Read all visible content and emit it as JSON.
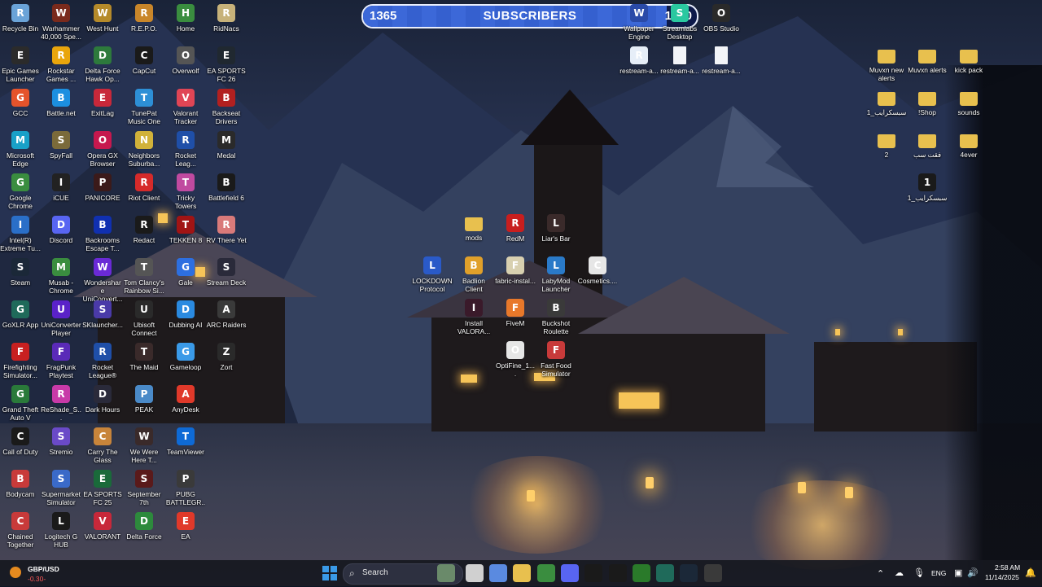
{
  "subscriber_widget": {
    "current": "1365",
    "label": "SUBSCRIBERS",
    "goal": "1500",
    "progress_fraction": 0.91
  },
  "desktop_icons": [
    {
      "label": "Recycle Bin",
      "icon": "recycle-bin-icon",
      "color": "#6aa3d8"
    },
    {
      "label": "Warhammer 40,000 Spe...",
      "icon": "warhammer-icon",
      "color": "#7a2a1c"
    },
    {
      "label": "West Hunt",
      "icon": "west-hunt-icon",
      "color": "#b58a2a"
    },
    {
      "label": "R.E.P.O.",
      "icon": "repo-icon",
      "color": "#c9862a"
    },
    {
      "label": "Home",
      "icon": "chrome-home-icon",
      "color": "#3a8d3f"
    },
    {
      "label": "RidNacs",
      "icon": "ridnacs-icon",
      "color": "#c7b27a"
    },
    {
      "label": "Epic Games Launcher",
      "icon": "epic-games-icon",
      "color": "#2b2b2b"
    },
    {
      "label": "Rockstar Games ...",
      "icon": "rockstar-icon",
      "color": "#e9a50c"
    },
    {
      "label": "Delta Force Hawk Op...",
      "icon": "delta-force-icon",
      "color": "#2d7a3c"
    },
    {
      "label": "CapCut",
      "icon": "capcut-icon",
      "color": "#1a1a1a"
    },
    {
      "label": "Overwolf",
      "icon": "overwolf-icon",
      "color": "#555555"
    },
    {
      "label": "EA SPORTS FC 26",
      "icon": "ea-fc26-icon",
      "color": "#202830"
    },
    {
      "label": "GCC",
      "icon": "gcc-icon",
      "color": "#e5532b"
    },
    {
      "label": "Battle.net",
      "icon": "battlenet-icon",
      "color": "#1c8fe0"
    },
    {
      "label": "ExitLag",
      "icon": "exitlag-icon",
      "color": "#c8283a"
    },
    {
      "label": "TunePat Music One",
      "icon": "tunepat-icon",
      "color": "#2d8fd6"
    },
    {
      "label": "Valorant Tracker",
      "icon": "valorant-tracker-icon",
      "color": "#e04555"
    },
    {
      "label": "Backseat Drivers",
      "icon": "backseat-drivers-icon",
      "color": "#b22020"
    },
    {
      "label": "Microsoft Edge",
      "icon": "edge-icon",
      "color": "#19a0c8"
    },
    {
      "label": "SpyFall",
      "icon": "spyfall-icon",
      "color": "#7a6a3a"
    },
    {
      "label": "Opera GX Browser",
      "icon": "opera-gx-icon",
      "color": "#c6184e"
    },
    {
      "label": "Neighbors Suburba...",
      "icon": "neighbors-icon",
      "color": "#d1b23a"
    },
    {
      "label": "Rocket Leag...",
      "icon": "rocket-league-icon",
      "color": "#1f4fa8"
    },
    {
      "label": "Medal",
      "icon": "medal-icon",
      "color": "#2a2a2a"
    },
    {
      "label": "Google Chrome",
      "icon": "chrome-icon",
      "color": "#3a8d3f"
    },
    {
      "label": "iCUE",
      "icon": "icue-icon",
      "color": "#222222"
    },
    {
      "label": "PANICORE",
      "icon": "panicore-icon",
      "color": "#3b1a1a"
    },
    {
      "label": "Riot Client",
      "icon": "riot-client-icon",
      "color": "#d62a2a"
    },
    {
      "label": "Tricky Towers",
      "icon": "tricky-towers-icon",
      "color": "#c04aa0"
    },
    {
      "label": "Battlefield 6",
      "icon": "battlefield-icon",
      "color": "#1a1a1a"
    },
    {
      "label": "Intel(R) Extreme Tu...",
      "icon": "intel-xtu-icon",
      "color": "#2a6fc8"
    },
    {
      "label": "Discord",
      "icon": "discord-icon",
      "color": "#5865f2"
    },
    {
      "label": "Backrooms Escape T...",
      "icon": "backrooms-icon",
      "color": "#1030b0"
    },
    {
      "label": "Redact",
      "icon": "redact-icon",
      "color": "#1a1a1a"
    },
    {
      "label": "TEKKEN 8",
      "icon": "tekken-icon",
      "color": "#a01414"
    },
    {
      "label": "RV There Yet",
      "icon": "rv-there-yet-icon",
      "color": "#d97a7a"
    },
    {
      "label": "Steam",
      "icon": "steam-icon",
      "color": "#1b2838"
    },
    {
      "label": "Musab - Chrome",
      "icon": "chrome-profile-icon",
      "color": "#3a8d3f"
    },
    {
      "label": "Wondershare UniConvert...",
      "icon": "uniconverter-icon",
      "color": "#6a2ad6"
    },
    {
      "label": "Tom Clancy's Rainbow Si...",
      "icon": "rainbow-six-icon",
      "color": "#555555"
    },
    {
      "label": "Gale",
      "icon": "gale-icon",
      "color": "#2d6fe0"
    },
    {
      "label": "Stream Deck",
      "icon": "stream-deck-icon",
      "color": "#2a2a3a"
    },
    {
      "label": "GoXLR App",
      "icon": "goxlr-icon",
      "color": "#1f6a5a"
    },
    {
      "label": "UniConverter Player",
      "icon": "uniconverter-player-icon",
      "color": "#5a22c8"
    },
    {
      "label": "SKlauncher...",
      "icon": "sklauncher-icon",
      "color": "#4a3aa8"
    },
    {
      "label": "Ubisoft Connect",
      "icon": "ubisoft-icon",
      "color": "#2a2a2a"
    },
    {
      "label": "Dubbing AI",
      "icon": "dubbing-ai-icon",
      "color": "#2a8ae0"
    },
    {
      "label": "ARC Raiders",
      "icon": "arc-raiders-icon",
      "color": "#3a3a3a"
    },
    {
      "label": "Firefighting Simulator...",
      "icon": "firefighting-icon",
      "color": "#c82020"
    },
    {
      "label": "FragPunk Playtest",
      "icon": "fragpunk-icon",
      "color": "#5a2ab8"
    },
    {
      "label": "Rocket League®",
      "icon": "rocket-league-2-icon",
      "color": "#1f4fa8"
    },
    {
      "label": "The Maid",
      "icon": "the-maid-icon",
      "color": "#3a2a2a"
    },
    {
      "label": "Gameloop",
      "icon": "gameloop-icon",
      "color": "#3a9ae8"
    },
    {
      "label": "Zort",
      "icon": "zort-icon",
      "color": "#2a2a2a"
    },
    {
      "label": "Grand Theft Auto V",
      "icon": "gta-v-icon",
      "color": "#2a7a3a"
    },
    {
      "label": "ReShade_S...",
      "icon": "reshade-icon",
      "color": "#c83aa8"
    },
    {
      "label": "Dark Hours",
      "icon": "dark-hours-icon",
      "color": "#2a2a3a"
    },
    {
      "label": "PEAK",
      "icon": "peak-icon",
      "color": "#4a8ac8"
    },
    {
      "label": "AnyDesk",
      "icon": "anydesk-icon",
      "color": "#e0392a"
    },
    {
      "label": "",
      "icon": "blank-slot",
      "color": ""
    },
    {
      "label": "Call of Duty",
      "icon": "call-of-duty-icon",
      "color": "#1a1a1a"
    },
    {
      "label": "Stremio",
      "icon": "stremio-icon",
      "color": "#6a4ac8"
    },
    {
      "label": "Carry The Glass",
      "icon": "carry-glass-icon",
      "color": "#c8843a"
    },
    {
      "label": "We Were Here T...",
      "icon": "we-were-here-icon",
      "color": "#3a2a2a"
    },
    {
      "label": "TeamViewer",
      "icon": "teamviewer-icon",
      "color": "#0e6ad6"
    },
    {
      "label": "",
      "icon": "blank-slot",
      "color": ""
    },
    {
      "label": "Bodycam",
      "icon": "bodycam-icon",
      "color": "#c83a3a"
    },
    {
      "label": "Supermarket Simulator",
      "icon": "supermarket-icon",
      "color": "#3a6ac8"
    },
    {
      "label": "EA SPORTS FC 25",
      "icon": "ea-fc25-icon",
      "color": "#1a6a3a"
    },
    {
      "label": "September 7th",
      "icon": "september-7th-icon",
      "color": "#5a1a1a"
    },
    {
      "label": "PUBG BATTLEGR...",
      "icon": "pubg-icon",
      "color": "#3a3a3a"
    },
    {
      "label": "",
      "icon": "blank-slot",
      "color": ""
    },
    {
      "label": "Chained Together",
      "icon": "chained-together-icon",
      "color": "#c83a3a"
    },
    {
      "label": "Logitech G HUB",
      "icon": "logitech-ghub-icon",
      "color": "#1a1a1a"
    },
    {
      "label": "VALORANT",
      "icon": "valorant-icon",
      "color": "#c8283a"
    },
    {
      "label": "Delta Force",
      "icon": "delta-force-2-icon",
      "color": "#2d8a3c"
    },
    {
      "label": "EA",
      "icon": "ea-icon",
      "color": "#e0392a"
    }
  ],
  "center_icons": [
    {
      "label": "mods",
      "icon": "folder-icon",
      "color": "#e8c04e"
    },
    {
      "label": "RedM",
      "icon": "redm-icon",
      "color": "#c81e1e"
    },
    {
      "label": "Liar's Bar",
      "icon": "liars-bar-icon",
      "color": "#3a2a2a"
    },
    {
      "label": "LOCKDOWN Protocol",
      "icon": "lockdown-icon",
      "color": "#2a5ac8"
    },
    {
      "label": "Badlion Client",
      "icon": "badlion-icon",
      "color": "#e0a02a"
    },
    {
      "label": "fabric-instal...",
      "icon": "fabric-installer-icon",
      "color": "#d8d0b0"
    },
    {
      "label": "LabyMod Launcher",
      "icon": "labymod-icon",
      "color": "#2a7ac8"
    },
    {
      "label": "Cosmetics....",
      "icon": "cosmetics-icon",
      "color": "#e6e6e6"
    },
    {
      "label": "Install VALORA...",
      "icon": "install-valorant-icon",
      "color": "#3a1a2a"
    },
    {
      "label": "FiveM",
      "icon": "fivem-icon",
      "color": "#e8782a"
    },
    {
      "label": "Buckshot Roulette",
      "icon": "buckshot-icon",
      "color": "#3a3a3a"
    },
    {
      "label": "OptiFine_1....",
      "icon": "optifine-icon",
      "color": "#e6e6e6"
    },
    {
      "label": "Fast Food Simulator",
      "icon": "fast-food-icon",
      "color": "#c83a3a"
    }
  ],
  "top_icons": [
    {
      "label": "Wallpaper Engine",
      "icon": "wallpaper-engine-icon",
      "color": "#2a4aa8"
    },
    {
      "label": "Streamlabs Desktop",
      "icon": "streamlabs-icon",
      "color": "#2ac8a0"
    },
    {
      "label": "OBS Studio",
      "icon": "obs-icon",
      "color": "#2a2a2a"
    },
    {
      "label": "restream-a...",
      "icon": "restream-icon",
      "color": "#e6eef8"
    },
    {
      "label": "restream-a...",
      "icon": "restream-file-icon",
      "color": "#f2f4f8"
    },
    {
      "label": "restream-a...",
      "icon": "restream-file-icon",
      "color": "#f2f4f8"
    }
  ],
  "right_folders": [
    {
      "label": "Muvxn new alerts",
      "icon": "folder-icon"
    },
    {
      "label": "Muvxn alerts",
      "icon": "folder-icon"
    },
    {
      "label": "kick pack",
      "icon": "folder-icon"
    },
    {
      "label": "سبسكرايب_1",
      "icon": "folder-icon"
    },
    {
      "label": "!Shop",
      "icon": "folder-icon"
    },
    {
      "label": "sounds",
      "icon": "folder-icon"
    },
    {
      "label": "2",
      "icon": "folder-icon"
    },
    {
      "label": "فقت سب",
      "icon": "folder-icon"
    },
    {
      "label": "4ever",
      "icon": "folder-icon"
    },
    {
      "label": "سبسكرايب_1",
      "icon": "video-file-icon"
    }
  ],
  "taskbar": {
    "widget_title": "GBP/USD",
    "widget_value": "-0.30-",
    "search_placeholder": "Search",
    "apps": [
      {
        "name": "start-button",
        "icon": "windows-icon",
        "color": "#3a9ae8"
      },
      {
        "name": "search-highlight",
        "icon": "search-highlight-icon",
        "color": "#6a8a6a"
      },
      {
        "name": "task-view",
        "icon": "task-view-icon",
        "color": "#d0d0d0"
      },
      {
        "name": "copilot",
        "icon": "copilot-icon",
        "color": "#5a8ae0"
      },
      {
        "name": "file-explorer",
        "icon": "file-explorer-icon",
        "color": "#e8c04e"
      },
      {
        "name": "chrome",
        "icon": "chrome-icon",
        "color": "#3a8d3f"
      },
      {
        "name": "discord",
        "icon": "discord-icon",
        "color": "#5865f2"
      },
      {
        "name": "netflix",
        "icon": "netflix-icon",
        "color": "#1a1a1a"
      },
      {
        "name": "sync-app",
        "icon": "sync-icon",
        "color": "#1a1a1a"
      },
      {
        "name": "nvidia",
        "icon": "nvidia-icon",
        "color": "#2a7a2a"
      },
      {
        "name": "goxlr",
        "icon": "goxlr-icon",
        "color": "#1f6a5a"
      },
      {
        "name": "steam",
        "icon": "steam-icon",
        "color": "#1b2838"
      },
      {
        "name": "obs",
        "icon": "obs-icon",
        "color": "#3a3a3a"
      }
    ],
    "language": "ENG",
    "time": "2:58 AM",
    "date": "11/14/2025"
  }
}
